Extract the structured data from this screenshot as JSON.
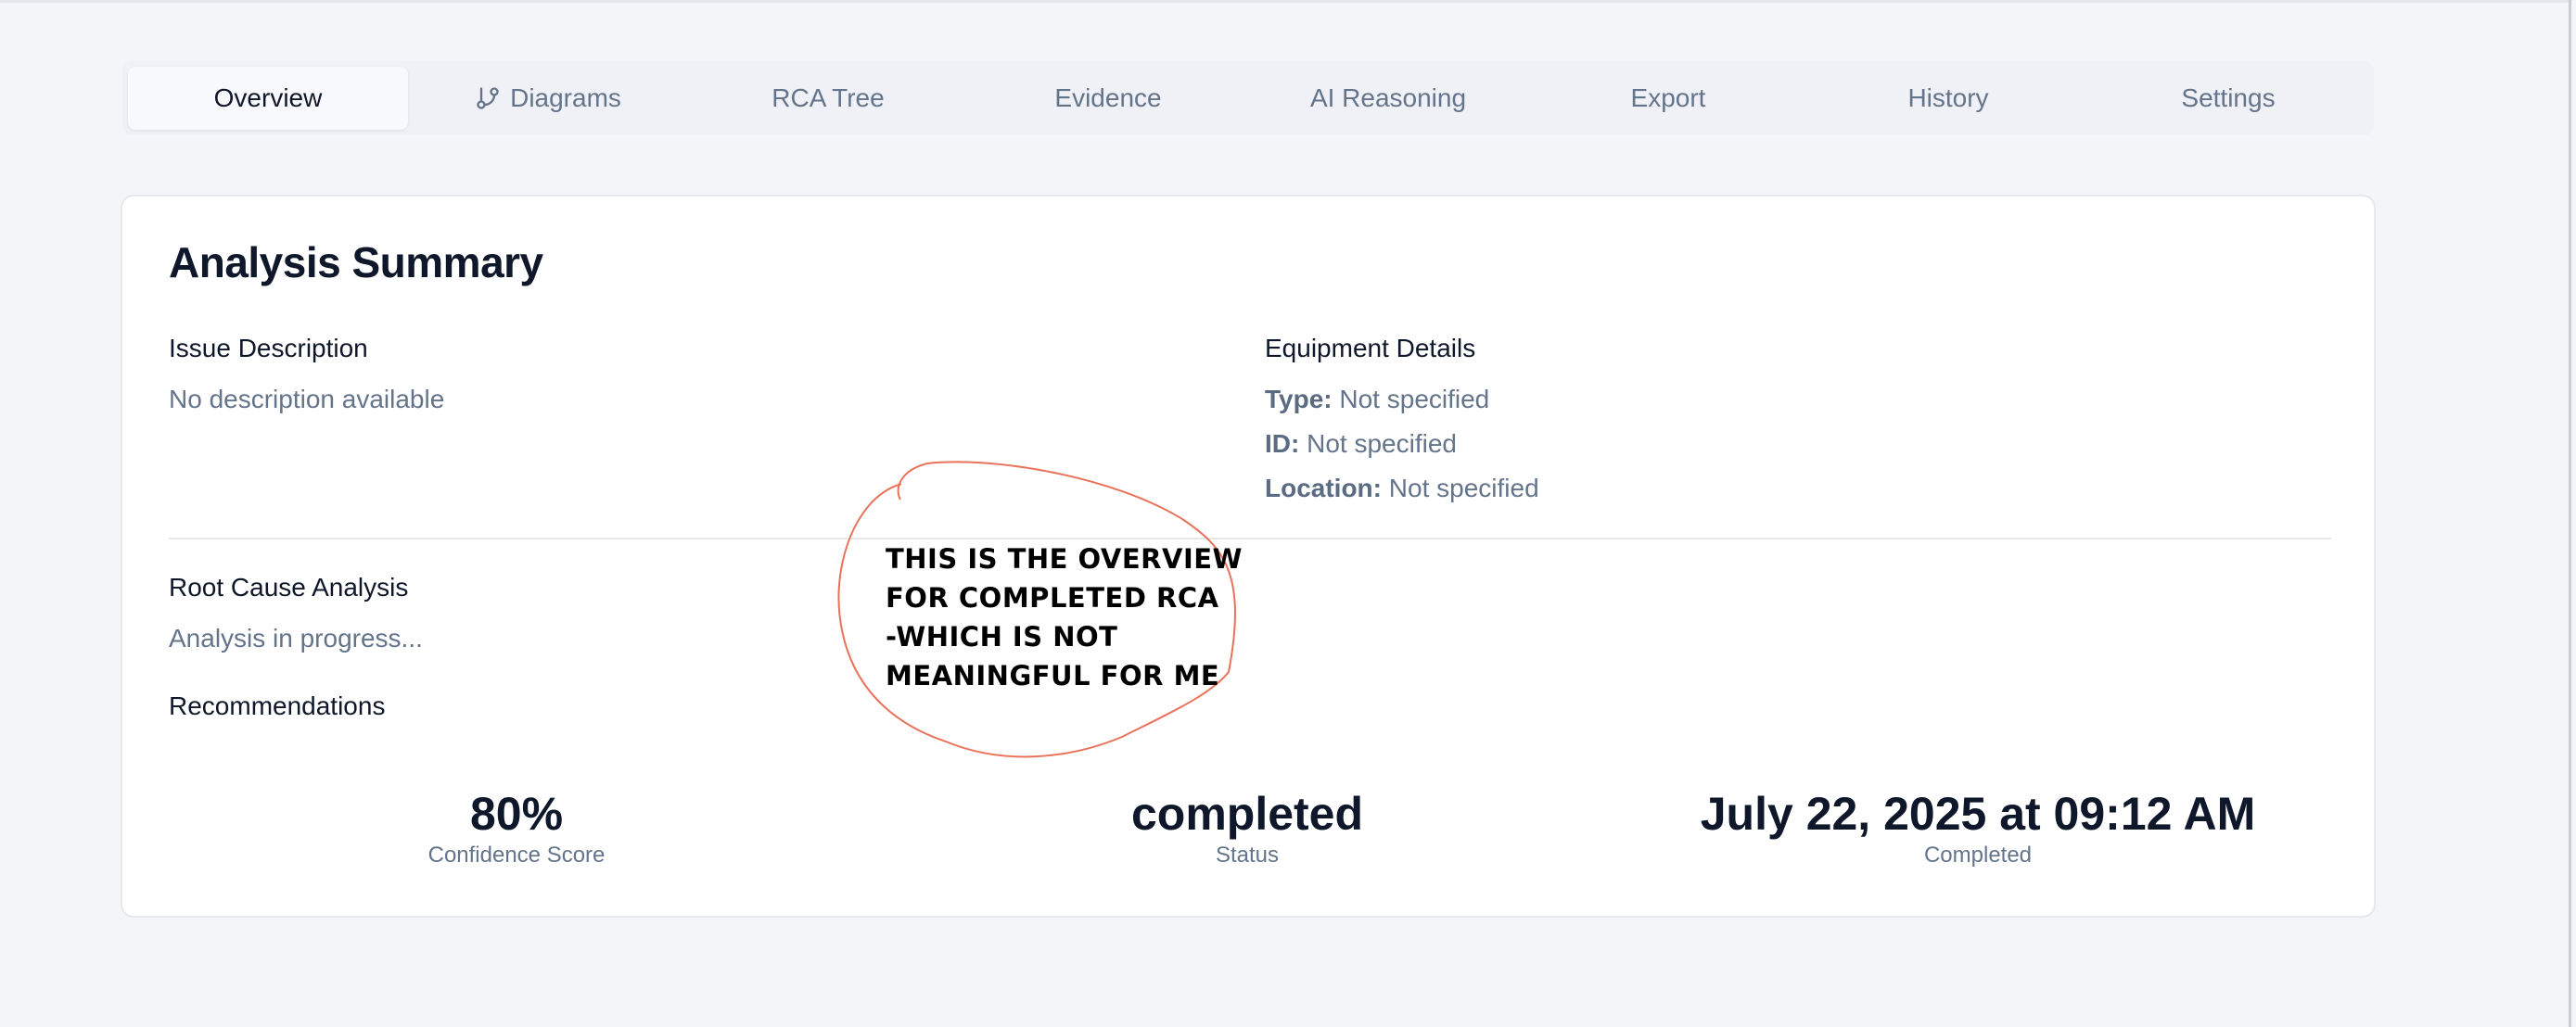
{
  "tabs": [
    {
      "label": "Overview",
      "active": true
    },
    {
      "label": "Diagrams",
      "icon": "git-branch-icon"
    },
    {
      "label": "RCA Tree"
    },
    {
      "label": "Evidence"
    },
    {
      "label": "AI Reasoning"
    },
    {
      "label": "Export"
    },
    {
      "label": "History"
    },
    {
      "label": "Settings"
    }
  ],
  "summary": {
    "title": "Analysis Summary",
    "issue": {
      "label": "Issue Description",
      "value": "No description available"
    },
    "equipment": {
      "label": "Equipment Details",
      "type_key": "Type:",
      "type_value": "Not specified",
      "id_key": "ID:",
      "id_value": "Not specified",
      "location_key": "Location:",
      "location_value": "Not specified"
    },
    "root_cause": {
      "label": "Root Cause Analysis",
      "value": "Analysis in progress..."
    },
    "recommendations": {
      "label": "Recommendations"
    },
    "stats": {
      "confidence_value": "80%",
      "confidence_label": "Confidence Score",
      "status_value": "completed",
      "status_label": "Status",
      "completed_value": "July 22, 2025 at 09:12 AM",
      "completed_label": "Completed"
    }
  },
  "annotation": {
    "text": "THIS IS THE OVERVIEW\nFOR COMPLETED RCA\n-WHICH IS NOT\nMEANINGFUL FOR ME",
    "color": "#e8735a"
  },
  "colors": {
    "page_bg": "#f4f5f9",
    "card_bg": "#ffffff",
    "muted_text": "#64748b",
    "primary_text": "#0f172a"
  }
}
